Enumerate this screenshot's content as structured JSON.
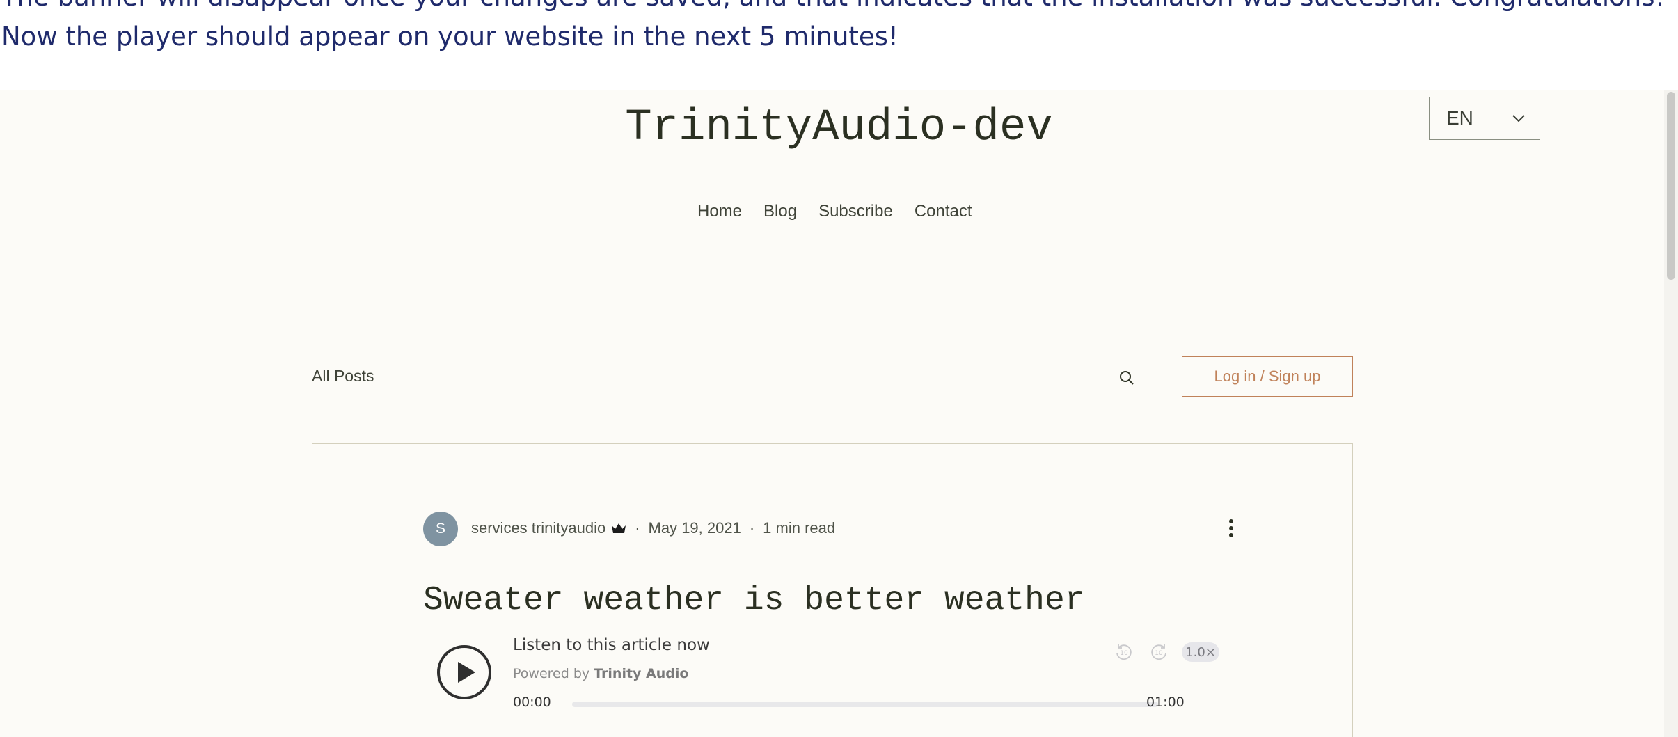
{
  "intro": {
    "line1": "The banner will disappear once your changes are saved, and that indicates that the installation was successful. Congratulations!",
    "line2": "Now the player should appear on your website in the next 5 minutes!"
  },
  "site": {
    "title": "TrinityAudio-dev",
    "language": "EN",
    "nav": [
      "Home",
      "Blog",
      "Subscribe",
      "Contact"
    ]
  },
  "blog": {
    "all_posts": "All Posts",
    "login_label": "Log in / Sign up"
  },
  "post": {
    "avatar_initial": "S",
    "author": "services trinityaudio",
    "date": "May 19, 2021",
    "read_time": "1 min read",
    "title": "Sweater weather is better weather"
  },
  "player": {
    "label": "Listen to this article now",
    "powered_prefix": "Powered by",
    "powered_brand": "Trinity Audio",
    "current_time": "00:00",
    "duration": "01:00",
    "speed": "1.0×",
    "progress": 0,
    "rewind_seconds": "10",
    "forward_seconds": "10"
  },
  "colors": {
    "intro_text": "#1f2a6b",
    "page_bg": "#fcfbf7",
    "accent": "#c0825a",
    "avatar": "#7f93a1"
  }
}
